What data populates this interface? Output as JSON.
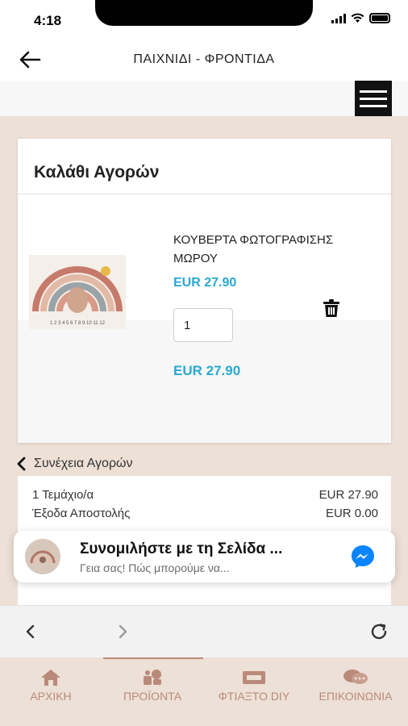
{
  "status_bar": {
    "time": "4:18"
  },
  "header": {
    "title": "ΠΑΙΧΝΙΔΙ - ΦΡΟΝΤΙΔΑ",
    "back_icon": "arrow-left-icon"
  },
  "menu": {
    "icon": "hamburger-menu-icon"
  },
  "cart": {
    "title": "Καλάθι Αγορών",
    "item": {
      "name": "ΚΟΥΒΕΡΤΑ ΦΩΤΟΓΡΑΦΙΣΗΣ ΜΩΡΟΥ",
      "price": "EUR 27.90",
      "quantity": "1",
      "line_total": "EUR 27.90",
      "image_text": "1 2 3 4 5 6 7 8 9 10 11 12"
    }
  },
  "continue_shopping": {
    "label": "Συνέχεια Αγορών"
  },
  "summary": {
    "rows": [
      {
        "label": "1 Τεμάχιο/α",
        "value": "EUR 27.90"
      },
      {
        "label": "Έξοδα Αποστολής",
        "value": "EUR 0.00"
      }
    ]
  },
  "chat": {
    "title": "Συνομιλήστε με τη Σελίδα ...",
    "subtitle": "Γεια σας! Πώς μπορούμε να..."
  },
  "browser_nav": {
    "back_icon": "chevron-left-icon",
    "forward_icon": "chevron-right-icon",
    "reload_icon": "reload-icon"
  },
  "tabs": [
    {
      "label": "ΑΡΧΙΚΗ",
      "icon": "home-icon",
      "active": false
    },
    {
      "label": "ΠΡΟΪΟΝΤΑ",
      "icon": "toys-icon",
      "active": true
    },
    {
      "label": "ΦΤΙΑΞΤΟ DIY",
      "icon": "diy-icon",
      "active": false
    },
    {
      "label": "ΕΠΙΚΟΙΝΩΝΙΑ",
      "icon": "contact-icon",
      "active": false
    }
  ],
  "colors": {
    "accent_blue": "#29a8d2",
    "tab_color": "#b98a7a",
    "page_bg": "#ede0d6",
    "messenger": "#0a84ff"
  }
}
